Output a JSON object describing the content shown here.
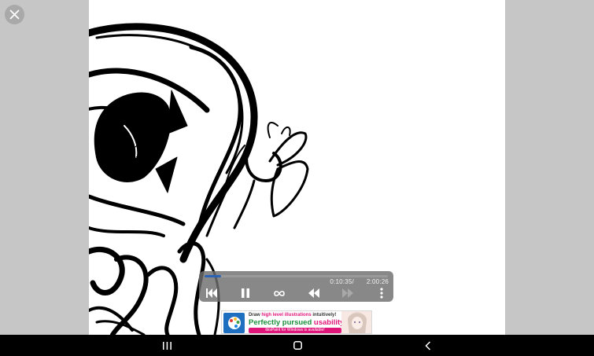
{
  "close": {
    "icon": "close-icon"
  },
  "player": {
    "progress": 0.088,
    "elapsed": "0:10:35/",
    "total": "2:00:26",
    "controls": [
      "skip-to-start-icon",
      "pause-icon",
      "loop-infinity-icon",
      "rewind-icon",
      "fast-forward-icon",
      "more-options-icon"
    ]
  },
  "ad": {
    "line1_a": "Draw ",
    "line1_b": "high level illustrations",
    "line1_c": " intuitively!",
    "line2_a": "Perfectly pursued ",
    "line2_b": "usability!",
    "line3": "ibisPaint for Windows is available!"
  },
  "navbar": {
    "recent": "recent-apps-icon",
    "home": "home-icon",
    "back": "back-icon"
  },
  "colors": {
    "progress": "#2d63b5",
    "ad_green": "#1b8f3c",
    "ad_pink": "#e0157a"
  }
}
